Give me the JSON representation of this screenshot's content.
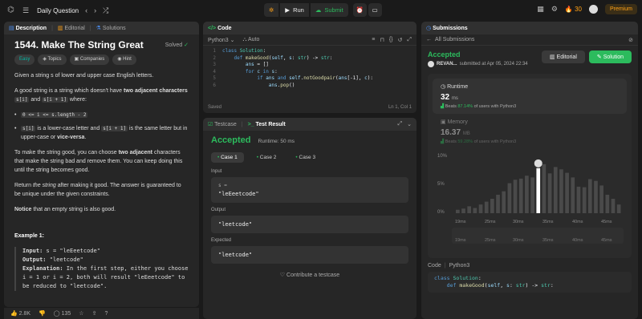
{
  "topbar": {
    "title": "Daily Question",
    "run": "Run",
    "submit": "Submit",
    "streak": "30",
    "premium": "Premium"
  },
  "left": {
    "tabs": [
      "Description",
      "Editorial",
      "Solutions"
    ],
    "title": "1544. Make The String Great",
    "solved": "Solved",
    "tags": [
      "Easy",
      "Topics",
      "Companies",
      "Hint"
    ],
    "p1": "Given a string s of lower and upper case English letters.",
    "p2a": "A good string is a string which doesn't have",
    "p2b": "two adjacent characters",
    "p2c": "s[i]",
    "p2d": "and",
    "p2e": "s[i + 1]",
    "p2f": "where:",
    "li1": "0 <= i <= s.length - 2",
    "li2a": "s[i]",
    "li2b": "is a lower-case letter and",
    "li2c": "s[i + 1]",
    "li2d": "is the same letter but in upper-case or",
    "li2e": "vice-versa",
    "p3a": "To make the string good, you can choose",
    "p3b": "two adjacent",
    "p3c": "characters that make the string bad and remove them. You can keep doing this until the string becomes good.",
    "p4a": "Return",
    "p4b": "the string",
    "p4c": "after making it good. The answer is guaranteed to be unique under the given constraints.",
    "p5a": "Notice",
    "p5b": "that an empty string is also good.",
    "ex_title": "Example 1:",
    "ex_input_label": "Input:",
    "ex_input": "s = \"leEeetcode\"",
    "ex_output_label": "Output:",
    "ex_output": "\"leetcode\"",
    "ex_expl_label": "Explanation:",
    "ex_expl": "In the first step, either you choose i = 1 or i = 2, both will result \"leEeetcode\" to be reduced to \"leetcode\".",
    "likes": "2.8K",
    "comments": "135"
  },
  "code": {
    "tab": "Code",
    "lang": "Python3",
    "auto": "Auto",
    "saved": "Saved",
    "pos": "Ln 1, Col 1",
    "lines": [
      "1",
      "2",
      "3",
      "4",
      "5",
      "6"
    ]
  },
  "test": {
    "tab1": "Testcase",
    "tab2": "Test Result",
    "status": "Accepted",
    "runtime": "Runtime: 50 ms",
    "cases": [
      "Case 1",
      "Case 2",
      "Case 3"
    ],
    "input_label": "Input",
    "input_var": "s =",
    "input_val": "\"leEeetcode\"",
    "output_label": "Output",
    "output_val": "\"leetcode\"",
    "expected_label": "Expected",
    "expected_val": "\"leetcode\"",
    "contribute": "Contribute a testcase"
  },
  "subs": {
    "tab": "Submissions",
    "back": "All Submissions",
    "status": "Accepted",
    "user": "REVAN...",
    "date": "submitted at Apr 05, 2024 22:34",
    "editorial": "Editorial",
    "solution": "Solution",
    "rt_label": "Runtime",
    "rt_val": "32",
    "rt_unit": "ms",
    "rt_beats": "Beats",
    "rt_pct": "87.14%",
    "rt_tail": "of users with Python3",
    "mem_label": "Memory",
    "mem_val": "16.37",
    "mem_unit": "MB",
    "mem_beats": "Beats",
    "mem_pct": "59.28%",
    "mem_tail": "of users with Python3",
    "y_ticks": [
      "10%",
      "5%",
      "0%"
    ],
    "x_ticks": [
      "19ms",
      "25ms",
      "30ms",
      "35ms",
      "40ms",
      "45ms"
    ],
    "x_ticks2": [
      "19ms",
      "25ms",
      "30ms",
      "35ms",
      "40ms",
      "45ms"
    ],
    "code_label": "Code",
    "code_lang": "Python3"
  },
  "chart_data": {
    "type": "bar",
    "ylim": [
      0,
      10
    ],
    "values": [
      0.6,
      0.8,
      1.2,
      0.9,
      1.5,
      2.0,
      2.5,
      3.2,
      3.8,
      5.2,
      5.8,
      6.0,
      6.5,
      6.2,
      7.8,
      8.5,
      6.9,
      8.0,
      7.6,
      7.0,
      6.2,
      4.6,
      4.5,
      5.9,
      5.6,
      4.8,
      3.2,
      2.5,
      1.5
    ],
    "highlight_index": 14
  }
}
